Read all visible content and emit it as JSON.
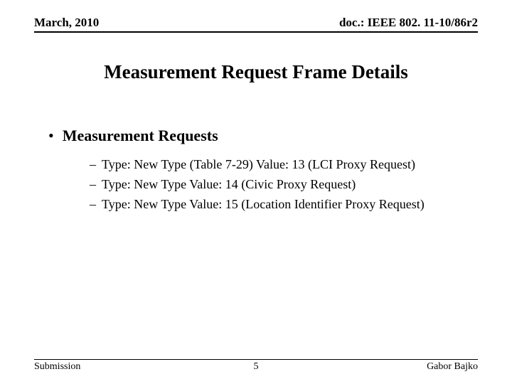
{
  "header": {
    "date": "March, 2010",
    "docref": "doc.: IEEE 802. 11-10/86r2"
  },
  "title": "Measurement Request Frame Details",
  "bullets": [
    {
      "label": "Measurement Requests",
      "subitems": [
        "Type: New Type (Table 7-29) Value: 13 (LCI Proxy Request)",
        "Type: New Type Value: 14 (Civic Proxy Request)",
        "Type: New Type Value: 15 (Location Identifier Proxy Request)"
      ]
    }
  ],
  "footer": {
    "left": "Submission",
    "center": "5",
    "right": "Gabor Bajko"
  }
}
